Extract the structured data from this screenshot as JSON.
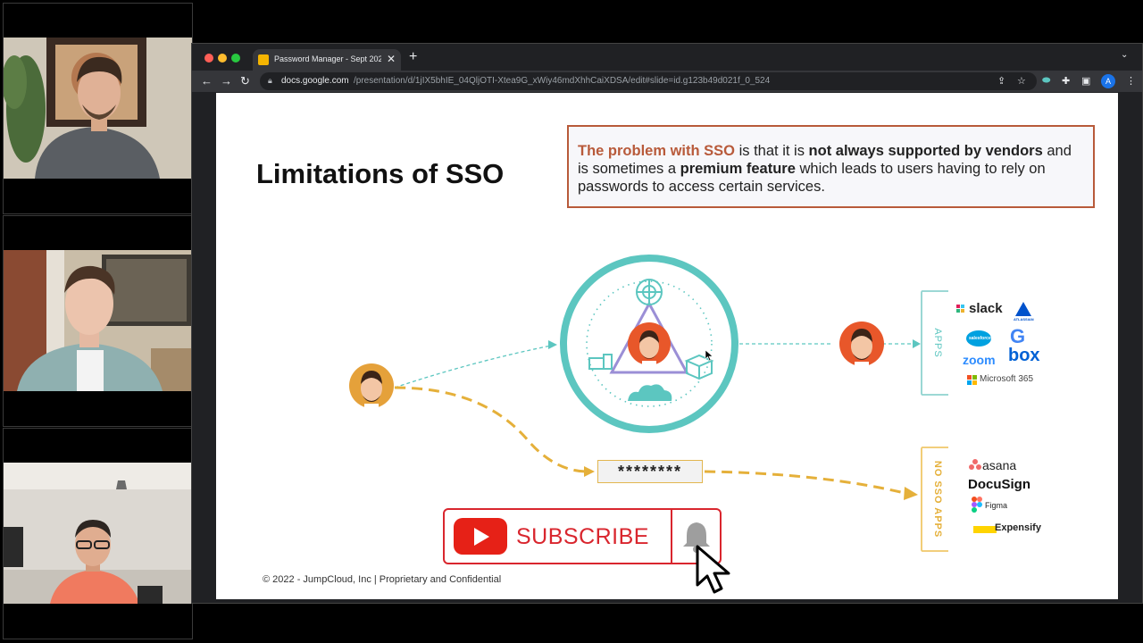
{
  "browser": {
    "tab_title": "Password Manager - Sept 2022",
    "url_domain": "docs.google.com",
    "url_path": "/presentation/d/1jIX5bhIE_04QljOTI-Xtea9G_xWiy46mdXhhCaiXDSA/edit#slide=id.g123b49d021f_0_524",
    "profile_initial": "A"
  },
  "slide": {
    "title": "Limitations of SSO",
    "callout": {
      "part1": "The problem with SSO",
      "part2": " is that it is ",
      "part3": "not always supported by vendors",
      "part4": " and is sometimes a ",
      "part5": "premium feature",
      "part6": " which leads to users having to rely on passwords to access certain services."
    },
    "password_mask": "********",
    "apps_label": "APPS",
    "no_sso_label": "NO SSO APPS",
    "apps": {
      "slack": "slack",
      "atlassian": "ATLASSIAN",
      "salesforce": "salesforce",
      "google": "G",
      "zoom": "zoom",
      "box": "box",
      "microsoft": "Microsoft 365"
    },
    "no_sso_apps": {
      "asana": "asana",
      "docusign": "DocuSign",
      "figma": "Figma",
      "expensify": "Expensify"
    },
    "footer": "© 2022 - JumpCloud, Inc | Proprietary and Confidential"
  },
  "overlay": {
    "subscribe_label": "SUBSCRIBE"
  },
  "colors": {
    "teal": "#5cc6c0",
    "orange": "#e8572a",
    "gold": "#e5b03a",
    "purple": "#9b8fd6",
    "callout_border": "#b85a3a",
    "youtube_red": "#e62117"
  }
}
